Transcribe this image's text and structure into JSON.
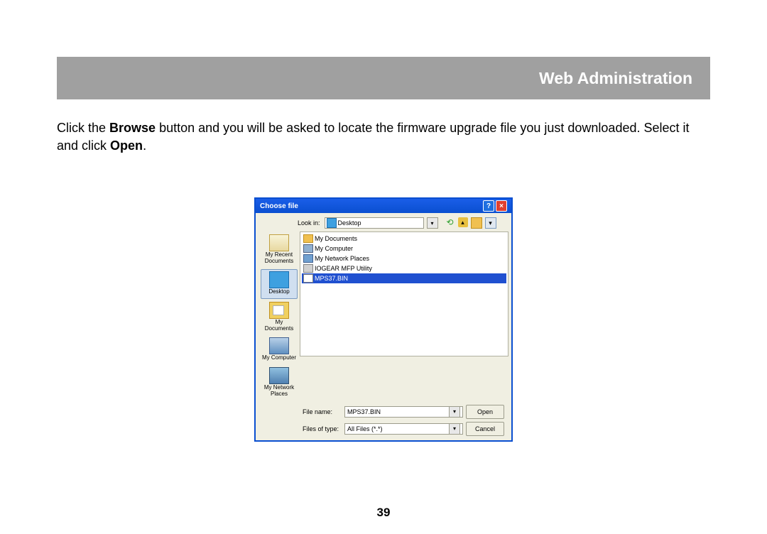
{
  "header": {
    "title": "Web Administration"
  },
  "instruction": {
    "pre": "Click the ",
    "b1": "Browse",
    "mid": " button and you will be asked to locate the firmware upgrade file you just downloaded. Select it and click ",
    "b2": "Open",
    "post": "."
  },
  "dialog": {
    "title": "Choose file",
    "lookin_label": "Look in:",
    "lookin_value": "Desktop",
    "sidebar": [
      {
        "label": "My Recent Documents"
      },
      {
        "label": "Desktop"
      },
      {
        "label": "My Documents"
      },
      {
        "label": "My Computer"
      },
      {
        "label": "My Network Places"
      }
    ],
    "files": [
      {
        "label": "My Documents",
        "kind": "folder"
      },
      {
        "label": "My Computer",
        "kind": "comp"
      },
      {
        "label": "My Network Places",
        "kind": "net"
      },
      {
        "label": "IOGEAR MFP Utility",
        "kind": "app"
      },
      {
        "label": "MPS37.BIN",
        "kind": "bin",
        "selected": true
      }
    ],
    "filename_label": "File name:",
    "filename_value": "MPS37.BIN",
    "filetype_label": "Files of type:",
    "filetype_value": "All Files (*.*)",
    "open_label": "Open",
    "cancel_label": "Cancel"
  },
  "page_number": "39"
}
